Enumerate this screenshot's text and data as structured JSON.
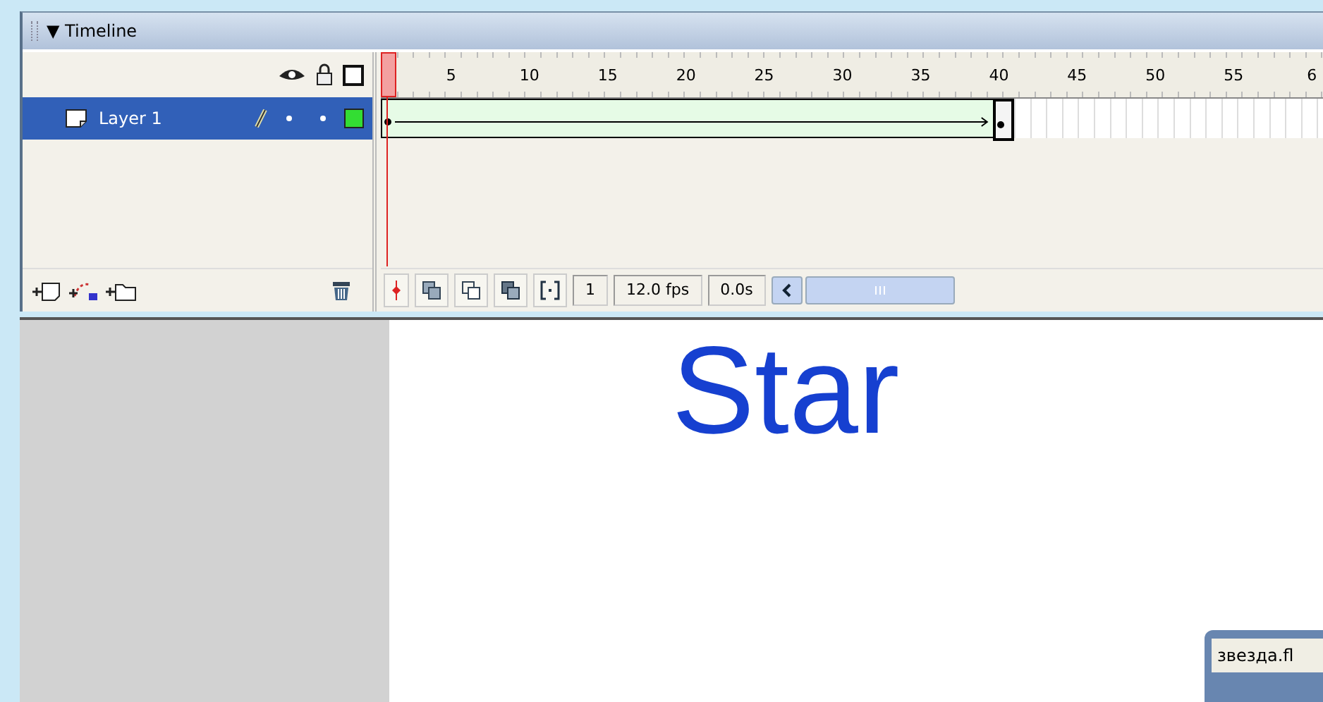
{
  "panel": {
    "title": "Timeline",
    "collapse_icon": "▼"
  },
  "ruler": {
    "labels": [
      "5",
      "10",
      "15",
      "20",
      "25",
      "30",
      "35",
      "40",
      "45",
      "50",
      "55",
      "6"
    ]
  },
  "layers": [
    {
      "name": "Layer 1",
      "selected": true,
      "color": "#33dd33",
      "motion_tween": true
    }
  ],
  "controls": {
    "frame": "1",
    "fps": "12.0 fps",
    "time": "0.0s"
  },
  "stage": {
    "text": "Star"
  },
  "document_window": {
    "title": "звезда.fl"
  }
}
